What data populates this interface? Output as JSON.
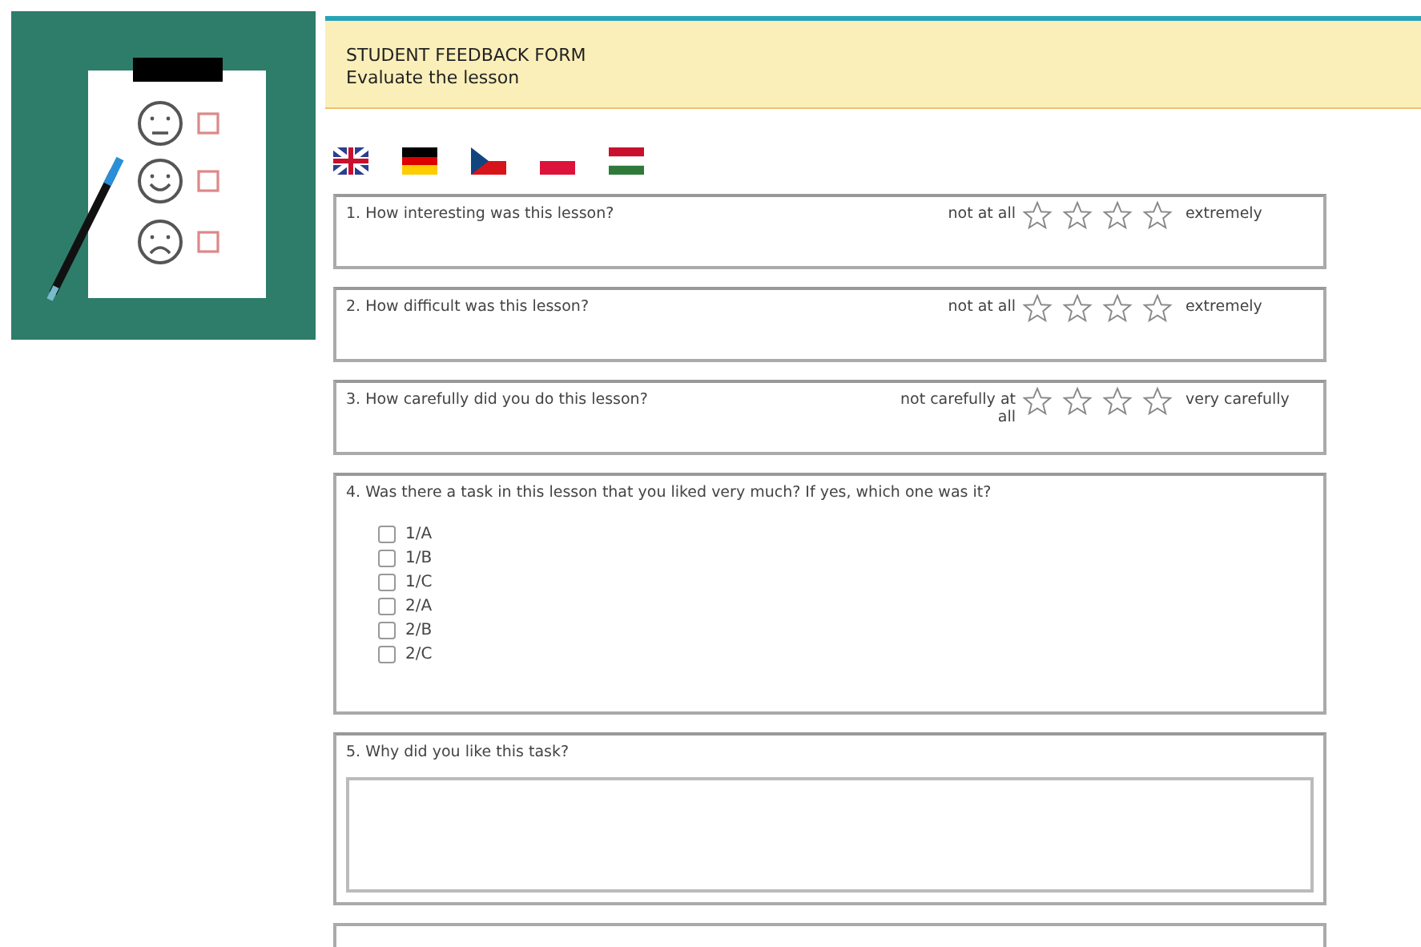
{
  "header": {
    "title": "STUDENT FEEDBACK FORM",
    "subtitle": "Evaluate the lesson"
  },
  "languages": [
    {
      "kind": "uk"
    },
    {
      "kind": "de"
    },
    {
      "kind": "cz"
    },
    {
      "kind": "pl"
    },
    {
      "kind": "hu"
    }
  ],
  "rating_questions": [
    {
      "question": "1. How interesting was this lesson?",
      "low_label": "not at all",
      "high_label": "extremely",
      "stars": 0
    },
    {
      "question": "2. How difficult was this lesson?",
      "low_label": "not at all",
      "high_label": "extremely",
      "stars": 0
    },
    {
      "question": "3. How carefully did you do this lesson?",
      "low_label": "not carefully at all",
      "high_label": "very carefully",
      "stars": 0
    }
  ],
  "task_question": {
    "question": "4. Was there a task in this lesson that you liked very much? If yes, which one was it?",
    "options": [
      {
        "label": "1/A",
        "checked": false
      },
      {
        "label": "1/B",
        "checked": false
      },
      {
        "label": "1/C",
        "checked": false
      },
      {
        "label": "2/A",
        "checked": false
      },
      {
        "label": "2/B",
        "checked": false
      },
      {
        "label": "2/C",
        "checked": false
      }
    ]
  },
  "reason_question": {
    "question": "5. Why did you like this task?"
  }
}
